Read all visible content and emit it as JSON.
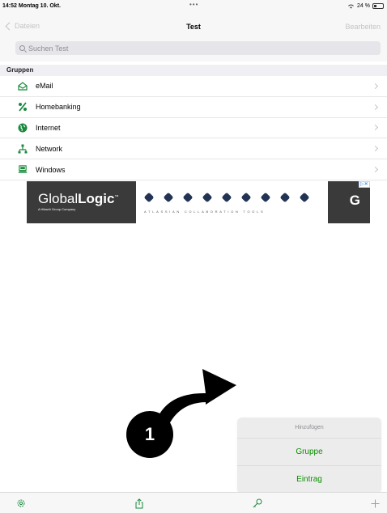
{
  "status_bar": {
    "time": "14:52",
    "date": "Montag 10. Okt.",
    "dots": "•••",
    "battery": "24 %"
  },
  "nav": {
    "back_label": "Dateien",
    "title": "Test",
    "edit_label": "Bearbeiten"
  },
  "search": {
    "placeholder": "Suchen Test"
  },
  "section": {
    "title": "Gruppen"
  },
  "groups": [
    {
      "label": "eMail",
      "icon": "envelope-icon",
      "color": "#1a8a3c"
    },
    {
      "label": "Homebanking",
      "icon": "percent-icon",
      "color": "#1a8a3c"
    },
    {
      "label": "Internet",
      "icon": "globe-icon",
      "color": "#1a8a3c"
    },
    {
      "label": "Network",
      "icon": "network-icon",
      "color": "#1a8a3c"
    },
    {
      "label": "Windows",
      "icon": "windows-icon",
      "color": "#1a8a3c"
    }
  ],
  "ad": {
    "brand_light": "Global",
    "brand_bold": "Logic",
    "brand_mark": "™",
    "brand_sub": "A Hitachi Group Company",
    "tagline": "ATLASSIAN COLLABORATION TOOLS",
    "logo_right": "G",
    "choice": "▷✕"
  },
  "annotation": {
    "step": "1"
  },
  "popup": {
    "title": "Hinzufügen",
    "items": [
      "Gruppe",
      "Eintrag"
    ]
  },
  "toolbar": {
    "icons": [
      "gear-icon",
      "share-icon",
      "key-icon",
      "plus-icon"
    ]
  },
  "colors": {
    "accent": "#0a8f00",
    "icon_green": "#1a8a3c",
    "disabled": "#c4c4c4"
  }
}
